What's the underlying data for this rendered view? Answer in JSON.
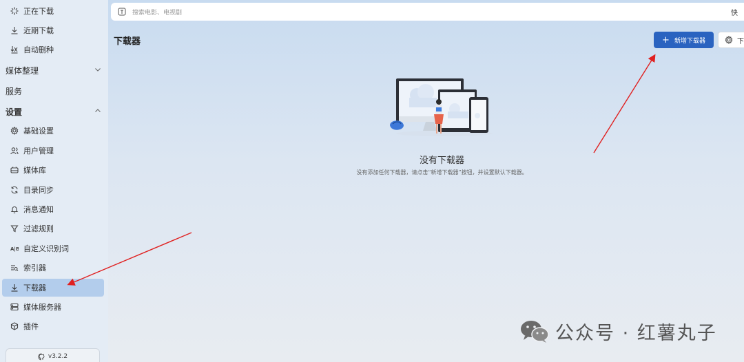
{
  "sidebar": {
    "items_top": [
      {
        "label": "正在下载",
        "icon": "loading-icon"
      },
      {
        "label": "近期下载",
        "icon": "download-icon"
      },
      {
        "label": "自动删种",
        "icon": "auto-delete-icon"
      }
    ],
    "groups": {
      "media": "媒体整理",
      "service": "服务",
      "settings": "设置"
    },
    "settings_items": [
      {
        "label": "基础设置",
        "icon": "gear-icon"
      },
      {
        "label": "用户管理",
        "icon": "users-icon"
      },
      {
        "label": "媒体库",
        "icon": "library-icon"
      },
      {
        "label": "目录同步",
        "icon": "sync-icon"
      },
      {
        "label": "消息通知",
        "icon": "bell-icon"
      },
      {
        "label": "过滤规则",
        "icon": "filter-icon"
      },
      {
        "label": "自定义识别词",
        "icon": "ab-icon"
      },
      {
        "label": "索引器",
        "icon": "indexer-icon"
      },
      {
        "label": "下载器",
        "icon": "download-icon",
        "active": true
      },
      {
        "label": "媒体服务器",
        "icon": "server-icon"
      },
      {
        "label": "插件",
        "icon": "plugin-icon"
      }
    ],
    "version": "v3.2.2"
  },
  "search": {
    "placeholder": "搜索电影、电视剧",
    "right_text": "快"
  },
  "page": {
    "title": "下载器",
    "add_button": "新增下载器",
    "settings_button": "下"
  },
  "empty": {
    "title": "没有下载器",
    "description": "没有添加任何下载器，请点击“新增下载器”按钮，并设置默认下载器。"
  },
  "watermark": {
    "text": "公众号 · 红薯丸子"
  },
  "colors": {
    "primary": "#2a63c0",
    "active_bg": "#b3cdec",
    "arrow": "#e02020"
  }
}
